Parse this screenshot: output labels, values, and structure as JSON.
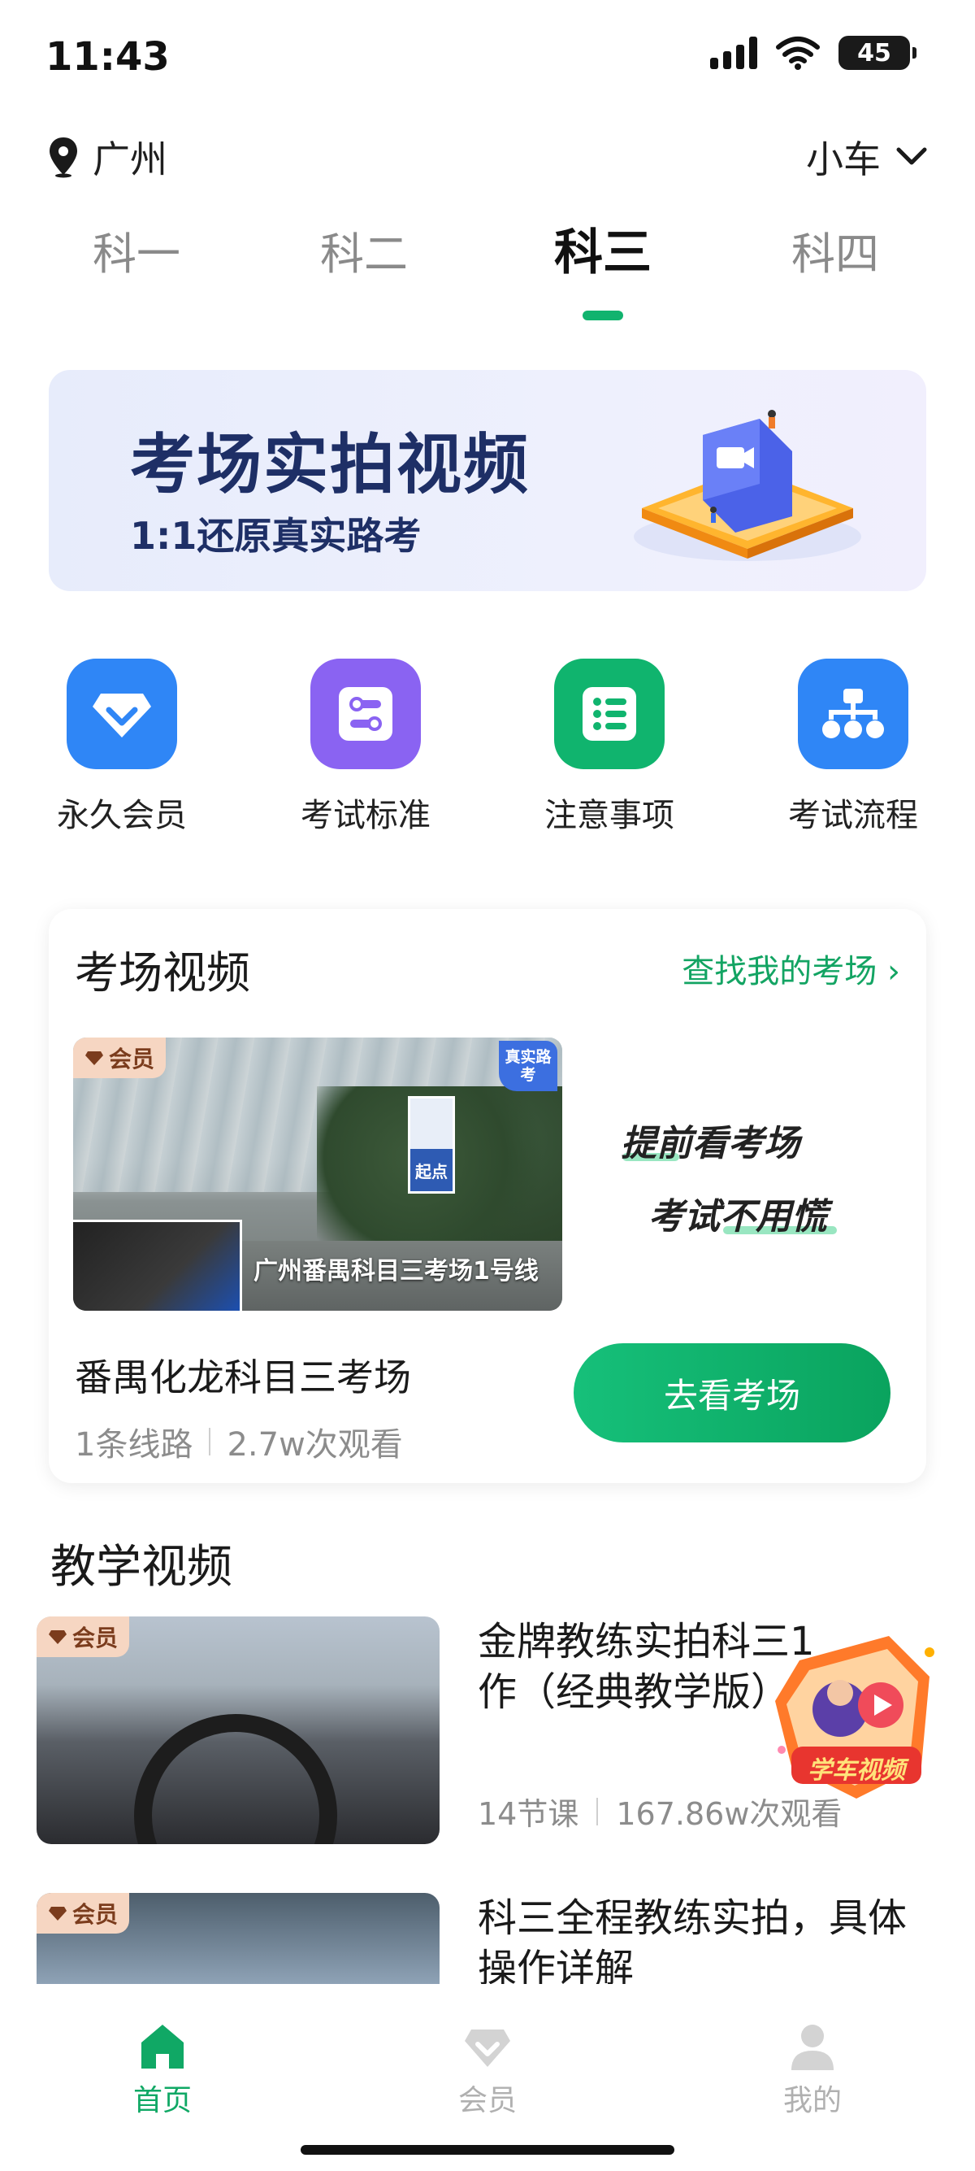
{
  "status_bar": {
    "time": "11:43",
    "battery": "45"
  },
  "location": {
    "city": "广州",
    "car_type": "小车"
  },
  "tabs": [
    {
      "label": "科一"
    },
    {
      "label": "科二"
    },
    {
      "label": "科三"
    },
    {
      "label": "科四"
    }
  ],
  "active_tab": "科三",
  "banner": {
    "title": "考场实拍视频",
    "subtitle": "1:1还原真实路考"
  },
  "quick_entries": [
    {
      "label": "永久会员",
      "icon": "diamond-icon",
      "color": "#2f86f6"
    },
    {
      "label": "考试标准",
      "icon": "list-toggle-icon",
      "color": "#8a63f2"
    },
    {
      "label": "注意事项",
      "icon": "checklist-icon",
      "color": "#10b46e"
    },
    {
      "label": "考试流程",
      "icon": "flowchart-icon",
      "color": "#2f86f6"
    }
  ],
  "venue_section": {
    "title": "考场视频",
    "link": "查找我的考场 ›",
    "badge": "会员",
    "real_badge": "真实路考",
    "sign_text": "起点",
    "thumb_caption": "广州番禺科目三考场1号线",
    "slogan_line1": "提前看考场",
    "slogan_line2": "考试不用慌",
    "venue_name": "番禺化龙科目三考场",
    "routes": "1条线路",
    "views": "2.7w次观看",
    "button": "去看考场"
  },
  "teaching_section": {
    "title": "教学视频",
    "videos": [
      {
        "badge": "会员",
        "title": "金牌教练实拍科三1…操作（经典教学版）",
        "title_line1": "金牌教练实拍科三1",
        "title_line2": "作（经典教学版）",
        "lessons": "14节课",
        "views": "167.86w次观看"
      },
      {
        "badge": "会员",
        "title_line1": "科三全程教练实拍，具体",
        "title_line2": "操作详解"
      }
    ]
  },
  "floating_badge": {
    "label": "学车视频"
  },
  "bottom_nav": [
    {
      "label": "首页",
      "icon": "home-icon",
      "active": true
    },
    {
      "label": "会员",
      "icon": "diamond-icon",
      "active": false
    },
    {
      "label": "我的",
      "icon": "user-icon",
      "active": false
    }
  ],
  "colors": {
    "brand_green": "#11b36e",
    "banner_text": "#1e2f66",
    "vip_badge": "#f6d6c2"
  }
}
